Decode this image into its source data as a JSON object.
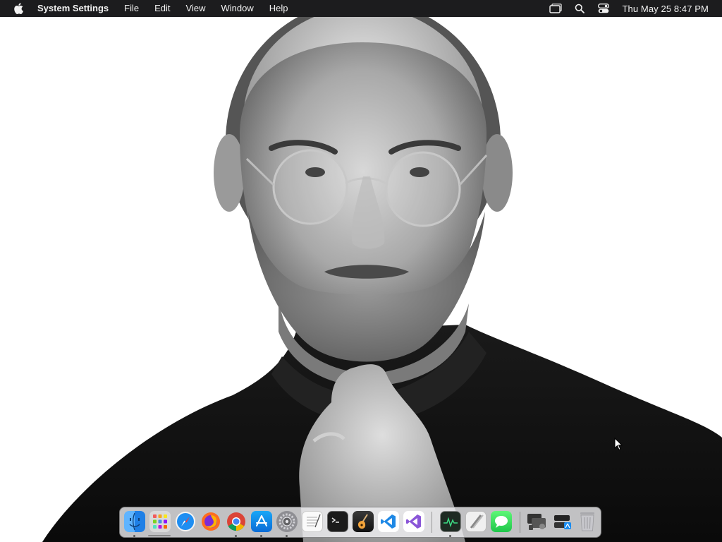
{
  "menubar": {
    "app_name": "System Settings",
    "menus": [
      "File",
      "Edit",
      "View",
      "Window",
      "Help"
    ],
    "clock": "Thu May 25  8:47 PM",
    "status_icons": [
      "screen-mirroring-icon",
      "spotlight-search-icon",
      "control-center-icon"
    ]
  },
  "wallpaper": {
    "subject": "black-and-white-portrait-photo"
  },
  "dock": {
    "apps": [
      {
        "name": "finder-icon",
        "running": true
      },
      {
        "name": "launchpad-icon",
        "running": false
      },
      {
        "name": "safari-icon",
        "running": false
      },
      {
        "name": "firefox-icon",
        "running": false
      },
      {
        "name": "chrome-icon",
        "running": true
      },
      {
        "name": "app-store-icon",
        "running": true
      },
      {
        "name": "system-settings-icon",
        "running": true
      },
      {
        "name": "textedit-icon",
        "running": false
      },
      {
        "name": "terminal-icon",
        "running": false
      },
      {
        "name": "garageband-icon",
        "running": false
      },
      {
        "name": "vscode-icon",
        "running": false
      },
      {
        "name": "visual-studio-icon",
        "running": false
      },
      {
        "name": "activity-monitor-icon",
        "running": true
      },
      {
        "name": "script-editor-icon",
        "running": false
      },
      {
        "name": "messages-icon",
        "running": false
      },
      {
        "name": "utilities-folder-icon",
        "running": false
      },
      {
        "name": "applications-folder-icon",
        "running": false
      },
      {
        "name": "trash-icon",
        "running": false
      }
    ]
  },
  "colors": {
    "menubar_bg": "#1c1c1e",
    "menubar_text": "#f2f2f2",
    "dock_bg": "#f5f5f7"
  }
}
